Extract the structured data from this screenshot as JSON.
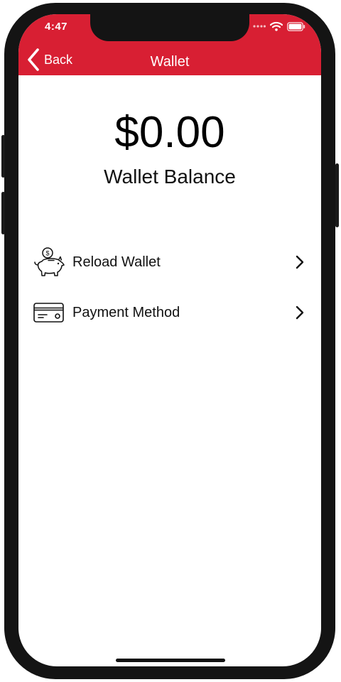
{
  "status_bar": {
    "time": "4:47",
    "icons": [
      "dots-signal-icon",
      "wifi-icon",
      "battery-icon"
    ]
  },
  "navbar": {
    "back_label": "Back",
    "title": "Wallet",
    "background_color": "#d81f33"
  },
  "balance": {
    "amount": "$0.00",
    "label": "Wallet Balance"
  },
  "menu": {
    "items": [
      {
        "label": "Reload Wallet",
        "icon": "piggy-bank-icon"
      },
      {
        "label": "Payment Method",
        "icon": "credit-card-icon"
      }
    ]
  }
}
